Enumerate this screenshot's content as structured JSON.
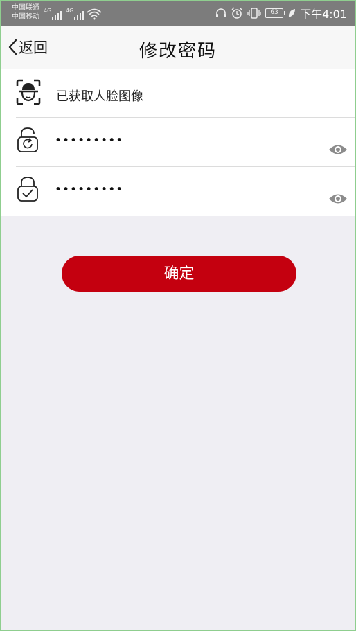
{
  "status_bar": {
    "carrier_1": "中国联通",
    "carrier_2": "中国移动",
    "network_1": "4G",
    "network_2": "4G",
    "battery": "63",
    "time": "下午4:01",
    "icons": [
      "wifi-icon",
      "headset-icon",
      "alarm-icon",
      "vibrate-icon",
      "battery-icon",
      "leaf-icon"
    ]
  },
  "nav": {
    "back_label": "返回",
    "title": "修改密码"
  },
  "form": {
    "face_label": "已获取人脸图像",
    "new_password_value": "•••••••••",
    "confirm_password_value": "•••••••••"
  },
  "actions": {
    "confirm_label": "确定"
  },
  "colors": {
    "accent": "#c4000f",
    "background": "#efeef3",
    "status_bar": "#7c7c7c"
  }
}
